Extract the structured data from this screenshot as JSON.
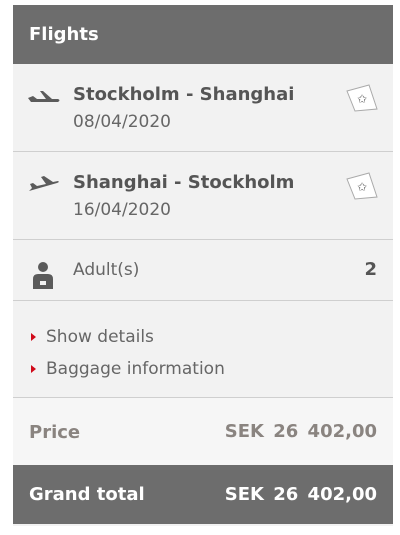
{
  "header": {
    "title": "Flights"
  },
  "flights": [
    {
      "route": "Stockholm - Shanghai",
      "date": "08/04/2020",
      "icon": "plane-departure-icon",
      "tag_icon": "star-alliance-tag-icon"
    },
    {
      "route": "Shanghai - Stockholm",
      "date": "16/04/2020",
      "icon": "plane-arrival-icon",
      "tag_icon": "star-alliance-tag-icon"
    }
  ],
  "passengers": {
    "label": "Adult(s)",
    "count": "2",
    "icon": "person-icon"
  },
  "links": {
    "show_details": "Show details",
    "baggage_information": "Baggage information"
  },
  "price": {
    "label": "Price",
    "value": "SEK 26 402,00"
  },
  "grand_total": {
    "label": "Grand total",
    "value": "SEK 26 402,00"
  },
  "colors": {
    "header_bg": "#6d6d6d",
    "panel_bg": "#f2f2f2",
    "accent_red": "#d00a1a",
    "price_text": "#8a8480"
  }
}
